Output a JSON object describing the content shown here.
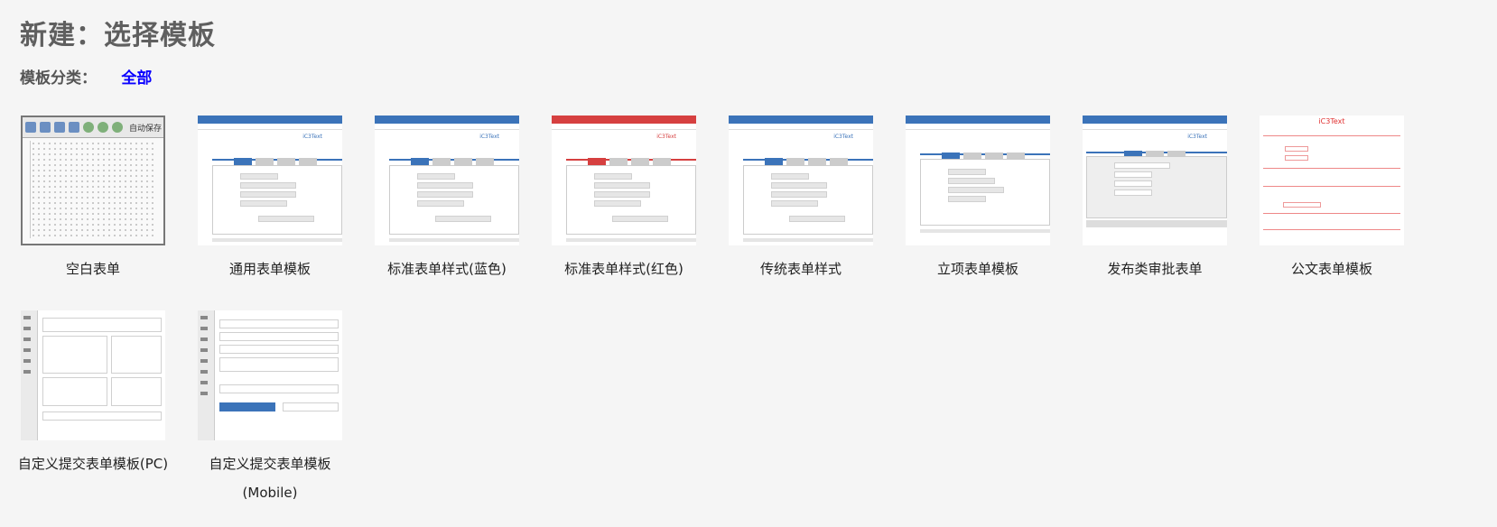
{
  "page": {
    "title": "新建：选择模板",
    "category_label": "模板分类：",
    "category_value": "全部"
  },
  "templates": [
    {
      "label": "空白表单",
      "thumb_toolbar_text": "自动保存"
    },
    {
      "label": "通用表单模板",
      "thumb_brand": "iC3Text",
      "accent": "#3b73b9"
    },
    {
      "label": "标准表单样式(蓝色)",
      "thumb_brand": "iC3Text",
      "accent": "#3b73b9"
    },
    {
      "label": "标准表单样式(红色)",
      "thumb_brand": "iC3Text",
      "accent": "#d64040"
    },
    {
      "label": "传统表单样式",
      "thumb_brand": "iC3Text",
      "accent": "#3b73b9"
    },
    {
      "label": "立项表单模板",
      "accent": "#3b73b9"
    },
    {
      "label": "发布类审批表单",
      "thumb_brand": "iC3Text",
      "accent": "#3b73b9"
    },
    {
      "label": "公文表单模板",
      "thumb_brand": "iC3Text",
      "accent": "#e03030"
    },
    {
      "label": "自定义提交表单模板(PC)"
    },
    {
      "label_line1": "自定义提交表单模板",
      "label_line2": "(Mobile)"
    }
  ]
}
